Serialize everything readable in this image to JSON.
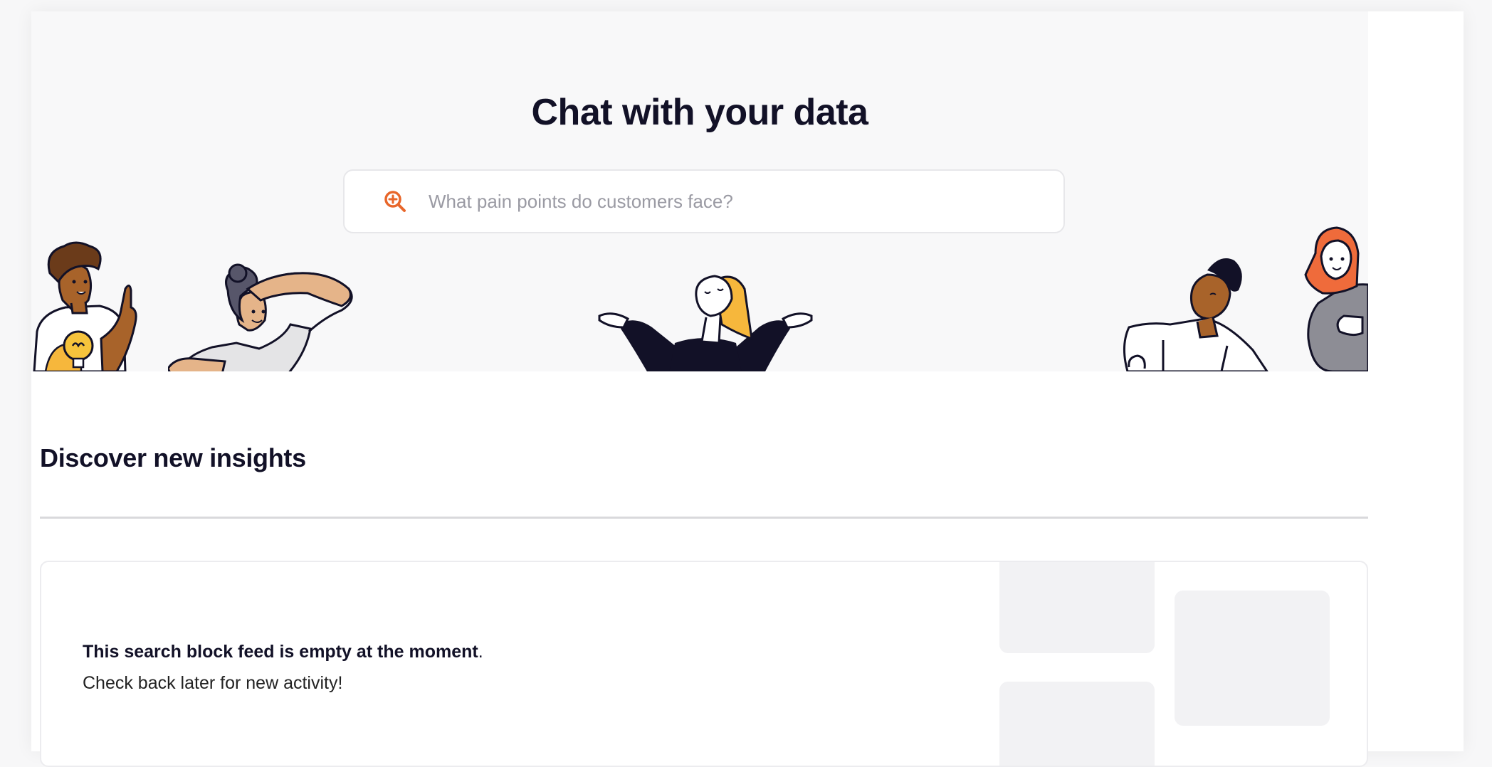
{
  "hero": {
    "title": "Chat with your data",
    "search_placeholder": "What pain points do customers face?",
    "search_icon": "zoom-in-magnifier-icon",
    "accent_color": "#e8662a"
  },
  "insights": {
    "title": "Discover new insights",
    "empty_title": "This search block feed is empty at the moment",
    "empty_suffix": ".",
    "empty_sub": "Check back later for new activity!"
  }
}
